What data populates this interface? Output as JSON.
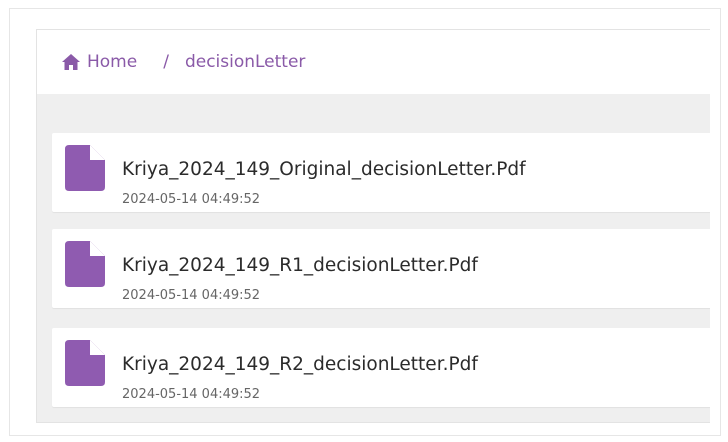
{
  "breadcrumb": {
    "home_label": "Home",
    "separator": "/",
    "current": "decisionLetter"
  },
  "files": [
    {
      "name": "Kriya_2024_149_Original_decisionLetter.Pdf",
      "date": "2024-05-14 04:49:52"
    },
    {
      "name": "Kriya_2024_149_R1_decisionLetter.Pdf",
      "date": "2024-05-14 04:49:52"
    },
    {
      "name": "Kriya_2024_149_R2_decisionLetter.Pdf",
      "date": "2024-05-14 04:49:52"
    }
  ],
  "icons": {
    "home": "home-icon",
    "file": "pdf-file-icon"
  },
  "colors": {
    "accent": "#8a5aa8",
    "file_icon": "#8f5bb0",
    "panel_background": "#efefef"
  }
}
